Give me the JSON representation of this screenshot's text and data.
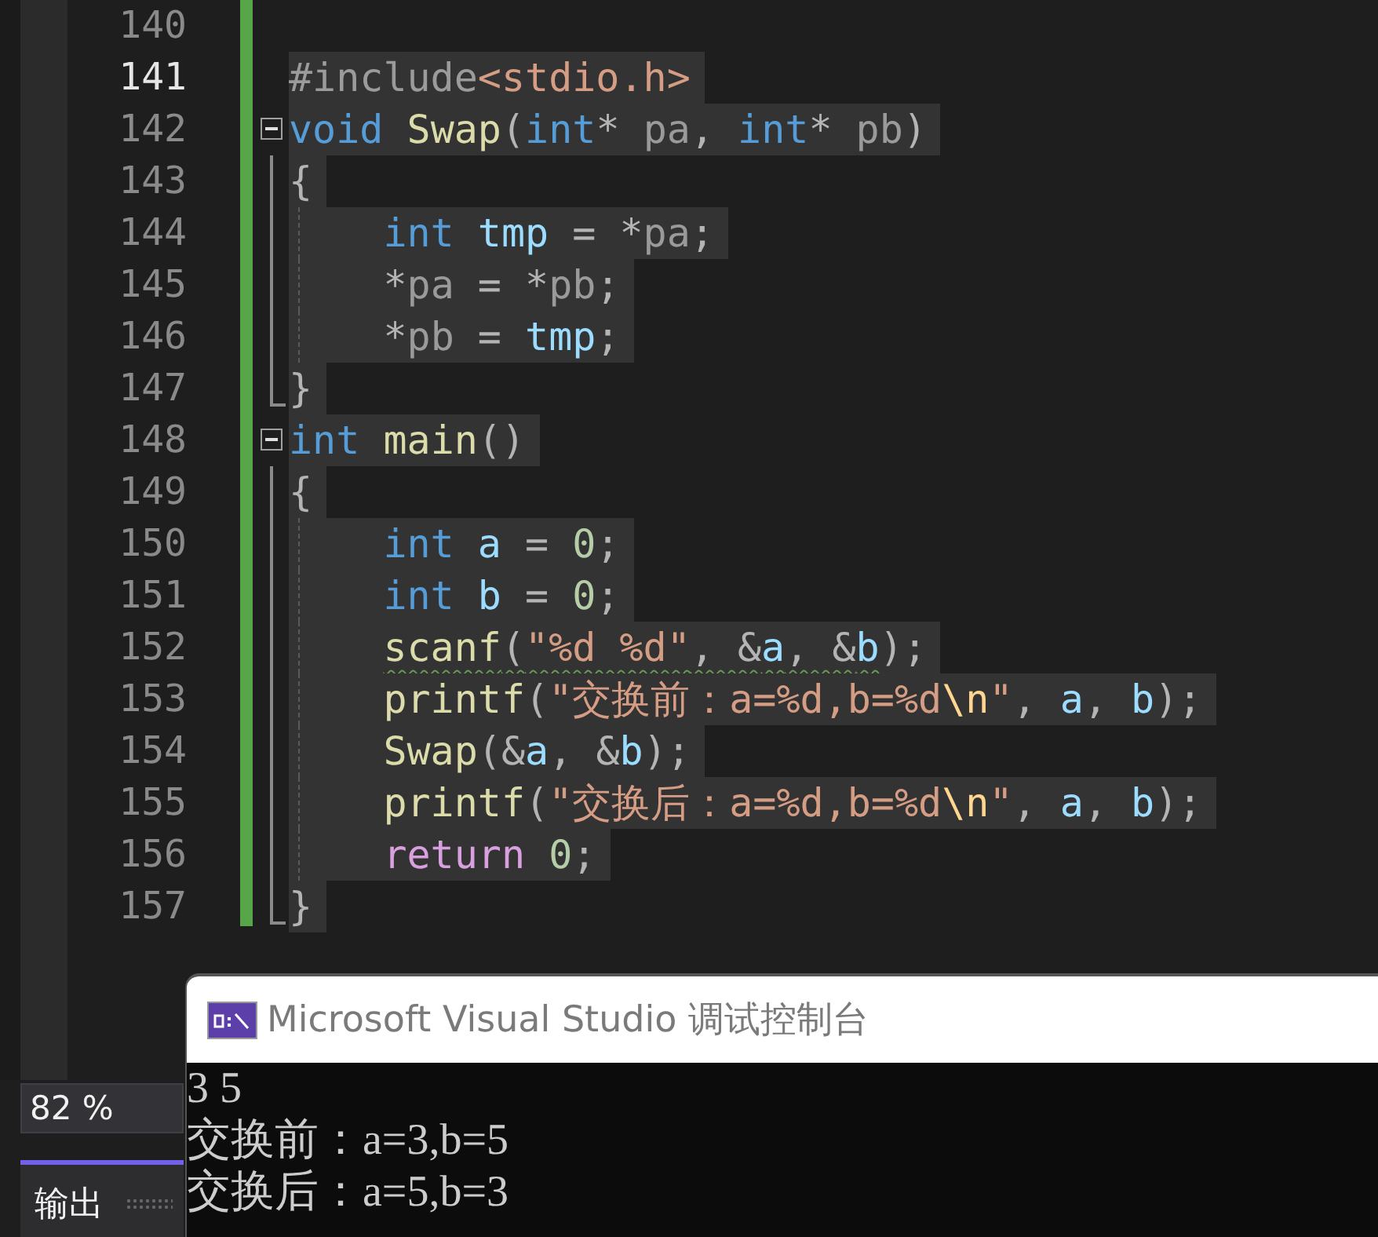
{
  "editor": {
    "lines": [
      {
        "number": "140",
        "kind": "blank",
        "current": false
      },
      {
        "number": "141",
        "kind": "top",
        "current": true,
        "selected": true,
        "tokens": [
          {
            "kind": "preproc",
            "text": "#include"
          },
          {
            "kind": "string",
            "text": "<stdio.h>"
          }
        ]
      },
      {
        "number": "142",
        "kind": "fold-start",
        "current": false,
        "selected": true,
        "tokens": [
          {
            "kind": "keyword",
            "text": "void "
          },
          {
            "kind": "function",
            "text": "Swap"
          },
          {
            "kind": "plain",
            "text": "("
          },
          {
            "kind": "keyword",
            "text": "int"
          },
          {
            "kind": "plain",
            "text": "* "
          },
          {
            "kind": "param",
            "text": "pa"
          },
          {
            "kind": "plain",
            "text": ", "
          },
          {
            "kind": "keyword",
            "text": "int"
          },
          {
            "kind": "plain",
            "text": "* "
          },
          {
            "kind": "param",
            "text": "pb"
          },
          {
            "kind": "plain",
            "text": ")"
          }
        ]
      },
      {
        "number": "143",
        "kind": "block",
        "current": false,
        "selected": true,
        "tokens": [
          {
            "kind": "plain",
            "text": "{"
          }
        ]
      },
      {
        "number": "144",
        "kind": "body",
        "current": false,
        "selected": true,
        "tokens": [
          {
            "kind": "keyword",
            "text": "int "
          },
          {
            "kind": "variable",
            "text": "tmp"
          },
          {
            "kind": "plain",
            "text": " = *"
          },
          {
            "kind": "param",
            "text": "pa"
          },
          {
            "kind": "plain",
            "text": ";"
          }
        ]
      },
      {
        "number": "145",
        "kind": "body",
        "current": false,
        "selected": true,
        "tokens": [
          {
            "kind": "plain",
            "text": "*"
          },
          {
            "kind": "param",
            "text": "pa"
          },
          {
            "kind": "plain",
            "text": " = *"
          },
          {
            "kind": "param",
            "text": "pb"
          },
          {
            "kind": "plain",
            "text": ";"
          }
        ]
      },
      {
        "number": "146",
        "kind": "body",
        "current": false,
        "selected": true,
        "tokens": [
          {
            "kind": "plain",
            "text": "*"
          },
          {
            "kind": "param",
            "text": "pb"
          },
          {
            "kind": "plain",
            "text": " = "
          },
          {
            "kind": "variable",
            "text": "tmp"
          },
          {
            "kind": "plain",
            "text": ";"
          }
        ]
      },
      {
        "number": "147",
        "kind": "block-end",
        "current": false,
        "selected": true,
        "tokens": [
          {
            "kind": "plain",
            "text": "}"
          }
        ]
      },
      {
        "number": "148",
        "kind": "fold-start",
        "current": false,
        "selected": true,
        "tokens": [
          {
            "kind": "keyword",
            "text": "int "
          },
          {
            "kind": "function",
            "text": "main"
          },
          {
            "kind": "plain",
            "text": "()"
          }
        ]
      },
      {
        "number": "149",
        "kind": "block",
        "current": false,
        "selected": true,
        "tokens": [
          {
            "kind": "plain",
            "text": "{"
          }
        ]
      },
      {
        "number": "150",
        "kind": "body",
        "current": false,
        "selected": true,
        "tokens": [
          {
            "kind": "keyword",
            "text": "int "
          },
          {
            "kind": "variable",
            "text": "a"
          },
          {
            "kind": "plain",
            "text": " = "
          },
          {
            "kind": "number",
            "text": "0"
          },
          {
            "kind": "plain",
            "text": ";"
          }
        ]
      },
      {
        "number": "151",
        "kind": "body",
        "current": false,
        "selected": true,
        "tokens": [
          {
            "kind": "keyword",
            "text": "int "
          },
          {
            "kind": "variable",
            "text": "b"
          },
          {
            "kind": "plain",
            "text": " = "
          },
          {
            "kind": "number",
            "text": "0"
          },
          {
            "kind": "plain",
            "text": ";"
          }
        ]
      },
      {
        "number": "152",
        "kind": "body",
        "current": false,
        "selected": true,
        "tokens": [
          {
            "kind": "function",
            "text": "scanf",
            "squiggle": true
          },
          {
            "kind": "plain",
            "text": "(",
            "squiggle": true
          },
          {
            "kind": "string",
            "text": "\"%d %d\"",
            "squiggle": true
          },
          {
            "kind": "plain",
            "text": ", &",
            "squiggle": true
          },
          {
            "kind": "variable",
            "text": "a",
            "squiggle": true
          },
          {
            "kind": "plain",
            "text": ", &",
            "squiggle": true
          },
          {
            "kind": "variable",
            "text": "b",
            "squiggle": true
          },
          {
            "kind": "plain",
            "text": ");"
          }
        ]
      },
      {
        "number": "153",
        "kind": "body",
        "current": false,
        "selected": true,
        "tokens": [
          {
            "kind": "function",
            "text": "printf"
          },
          {
            "kind": "plain",
            "text": "("
          },
          {
            "kind": "string",
            "text": "\"交换前：a=%d,b=%d"
          },
          {
            "kind": "escape",
            "text": "\\n"
          },
          {
            "kind": "string",
            "text": "\""
          },
          {
            "kind": "plain",
            "text": ", "
          },
          {
            "kind": "variable",
            "text": "a"
          },
          {
            "kind": "plain",
            "text": ", "
          },
          {
            "kind": "variable",
            "text": "b"
          },
          {
            "kind": "plain",
            "text": ");"
          }
        ]
      },
      {
        "number": "154",
        "kind": "body",
        "current": false,
        "selected": true,
        "tokens": [
          {
            "kind": "function",
            "text": "Swap"
          },
          {
            "kind": "plain",
            "text": "(&"
          },
          {
            "kind": "variable",
            "text": "a"
          },
          {
            "kind": "plain",
            "text": ", &"
          },
          {
            "kind": "variable",
            "text": "b"
          },
          {
            "kind": "plain",
            "text": ");"
          }
        ]
      },
      {
        "number": "155",
        "kind": "body",
        "current": false,
        "selected": true,
        "tokens": [
          {
            "kind": "function",
            "text": "printf"
          },
          {
            "kind": "plain",
            "text": "("
          },
          {
            "kind": "string",
            "text": "\"交换后：a=%d,b=%d"
          },
          {
            "kind": "escape",
            "text": "\\n"
          },
          {
            "kind": "string",
            "text": "\""
          },
          {
            "kind": "plain",
            "text": ", "
          },
          {
            "kind": "variable",
            "text": "a"
          },
          {
            "kind": "plain",
            "text": ", "
          },
          {
            "kind": "variable",
            "text": "b"
          },
          {
            "kind": "plain",
            "text": ");"
          }
        ]
      },
      {
        "number": "156",
        "kind": "body",
        "current": false,
        "selected": true,
        "tokens": [
          {
            "kind": "control",
            "text": "return "
          },
          {
            "kind": "number",
            "text": "0"
          },
          {
            "kind": "plain",
            "text": ";"
          }
        ]
      },
      {
        "number": "157",
        "kind": "block-end",
        "current": false,
        "selected": true,
        "tokens": [
          {
            "kind": "plain",
            "text": "}"
          }
        ]
      }
    ]
  },
  "zoom": {
    "value": "82 %"
  },
  "panel_tabs": [
    {
      "label": "输出",
      "selected": true
    }
  ],
  "console": {
    "title": "Microsoft Visual Studio 调试控制台",
    "output": [
      "3 5",
      "交换前：a=3,b=5",
      "交换后：a=5,b=3"
    ]
  }
}
